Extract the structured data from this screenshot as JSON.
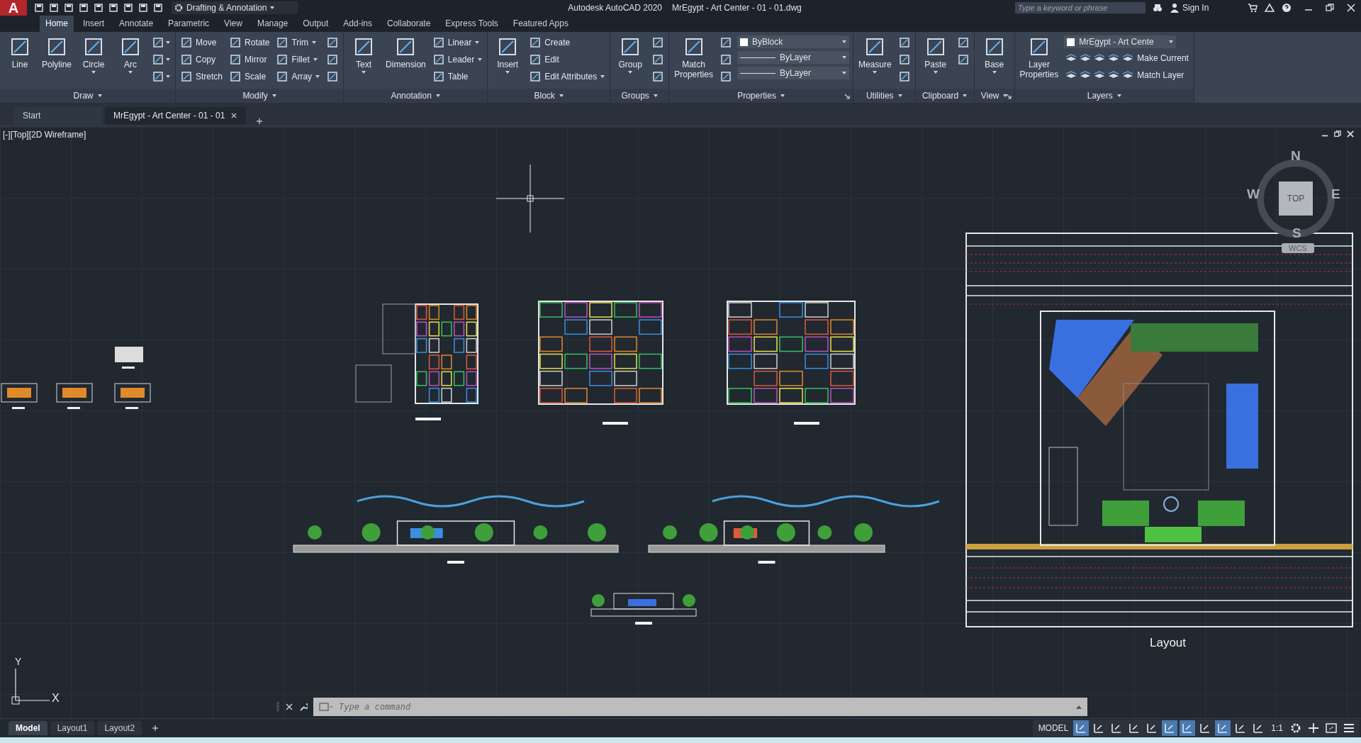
{
  "title_bar": {
    "logo": "A",
    "workspace": "Drafting & Annotation",
    "app_title": "Autodesk AutoCAD 2020",
    "file_title": "MrEgypt - Art Center - 01 - 01.dwg",
    "search": {
      "placeholder": "Type a keyword or phrase"
    },
    "sign_in": "Sign In"
  },
  "ribbon_tabs": [
    {
      "label": "Home",
      "selected": true
    },
    {
      "label": "Insert",
      "selected": false
    },
    {
      "label": "Annotate",
      "selected": false
    },
    {
      "label": "Parametric",
      "selected": false
    },
    {
      "label": "View",
      "selected": false
    },
    {
      "label": "Manage",
      "selected": false
    },
    {
      "label": "Output",
      "selected": false
    },
    {
      "label": "Add-ins",
      "selected": false
    },
    {
      "label": "Collaborate",
      "selected": false
    },
    {
      "label": "Express Tools",
      "selected": false
    },
    {
      "label": "Featured Apps",
      "selected": false
    }
  ],
  "panels": [
    {
      "title": "Draw",
      "launcher": false,
      "columns": [
        [
          {
            "kind": "large",
            "label": "Line",
            "dropdown": false
          }
        ],
        [
          {
            "kind": "large",
            "label": "Polyline",
            "dropdown": false
          }
        ],
        [
          {
            "kind": "large",
            "label": "Circle",
            "dropdown": true
          }
        ],
        [
          {
            "kind": "large",
            "label": "Arc",
            "dropdown": true
          }
        ],
        [
          {
            "kind": "icon",
            "dropdown": true
          },
          {
            "kind": "icon",
            "dropdown": true
          },
          {
            "kind": "icon",
            "dropdown": true
          }
        ]
      ]
    },
    {
      "title": "Modify",
      "launcher": false,
      "columns": [
        [
          {
            "kind": "small",
            "label": "Move",
            "dropdown": false
          },
          {
            "kind": "small",
            "label": "Copy",
            "dropdown": false
          },
          {
            "kind": "small",
            "label": "Stretch",
            "dropdown": false
          }
        ],
        [
          {
            "kind": "small",
            "label": "Rotate",
            "dropdown": false
          },
          {
            "kind": "small",
            "label": "Mirror",
            "dropdown": false
          },
          {
            "kind": "small",
            "label": "Scale",
            "dropdown": false
          }
        ],
        [
          {
            "kind": "small",
            "label": "Trim",
            "dropdown": true
          },
          {
            "kind": "small",
            "label": "Fillet",
            "dropdown": true
          },
          {
            "kind": "small",
            "label": "Array",
            "dropdown": true
          }
        ],
        [
          {
            "kind": "icon",
            "dropdown": false
          },
          {
            "kind": "icon",
            "dropdown": false
          },
          {
            "kind": "icon",
            "dropdown": false
          }
        ]
      ]
    },
    {
      "title": "Annotation",
      "launcher": false,
      "columns": [
        [
          {
            "kind": "large",
            "label": "Text",
            "dropdown": true
          }
        ],
        [
          {
            "kind": "large",
            "label": "Dimension",
            "dropdown": false
          }
        ],
        [
          {
            "kind": "small",
            "label": "Linear",
            "dropdown": true
          },
          {
            "kind": "small",
            "label": "Leader",
            "dropdown": true
          },
          {
            "kind": "small",
            "label": "Table",
            "dropdown": false
          }
        ]
      ]
    },
    {
      "title": "Block",
      "launcher": false,
      "columns": [
        [
          {
            "kind": "large",
            "label": "Insert",
            "dropdown": true
          }
        ],
        [
          {
            "kind": "small",
            "label": "Create",
            "dropdown": false
          },
          {
            "kind": "small",
            "label": "Edit",
            "dropdown": false
          },
          {
            "kind": "small",
            "label": "Edit Attributes",
            "dropdown": true
          }
        ]
      ]
    },
    {
      "title": "Groups",
      "launcher": false,
      "columns": [
        [
          {
            "kind": "large",
            "label": "Group",
            "dropdown": true
          }
        ],
        [
          {
            "kind": "icon",
            "dropdown": false
          },
          {
            "kind": "icon",
            "dropdown": false
          },
          {
            "kind": "icon",
            "dropdown": false
          }
        ]
      ]
    },
    {
      "title": "Properties",
      "launcher": true,
      "columns": [
        [
          {
            "kind": "large",
            "label": "Match Properties",
            "dropdown": false
          }
        ],
        [
          {
            "kind": "icon",
            "dropdown": false
          },
          {
            "kind": "icon",
            "dropdown": false
          },
          {
            "kind": "icon",
            "dropdown": false
          }
        ],
        [
          {
            "kind": "combo",
            "value": "ByBlock",
            "swatch": true,
            "line_sample": false
          },
          {
            "kind": "combo",
            "value": "ByLayer",
            "swatch": false,
            "line_sample": true
          },
          {
            "kind": "combo",
            "value": "ByLayer",
            "swatch": false,
            "line_sample": true
          }
        ]
      ]
    },
    {
      "title": "Utilities",
      "launcher": false,
      "columns": [
        [
          {
            "kind": "large",
            "label": "Measure",
            "dropdown": true
          }
        ],
        [
          {
            "kind": "icon",
            "dropdown": false
          },
          {
            "kind": "icon",
            "dropdown": false
          },
          {
            "kind": "icon",
            "dropdown": false
          }
        ]
      ]
    },
    {
      "title": "Clipboard",
      "launcher": false,
      "columns": [
        [
          {
            "kind": "large",
            "label": "Paste",
            "dropdown": true
          }
        ],
        [
          {
            "kind": "icon",
            "dropdown": false
          },
          {
            "kind": "icon",
            "dropdown": false
          }
        ]
      ]
    },
    {
      "title": "View",
      "launcher": true,
      "columns": [
        [
          {
            "kind": "large",
            "label": "Base",
            "dropdown": true
          }
        ]
      ]
    },
    {
      "title": "Layers",
      "launcher": false,
      "columns": [
        [
          {
            "kind": "large",
            "label": "Layer Properties",
            "dropdown": false
          }
        ],
        [
          {
            "kind": "combo",
            "value": "MrEgypt - Art Cente",
            "swatch": true,
            "line_sample": false
          },
          {
            "kind": "row",
            "items": [
              {
                "kind": "icon",
                "dropdown": false
              },
              {
                "kind": "icon",
                "dropdown": false
              },
              {
                "kind": "icon",
                "dropdown": false
              },
              {
                "kind": "icon",
                "dropdown": false
              },
              {
                "kind": "small",
                "label": "Make Current",
                "dropdown": false
              }
            ]
          },
          {
            "kind": "row",
            "items": [
              {
                "kind": "icon",
                "dropdown": false
              },
              {
                "kind": "icon",
                "dropdown": false
              },
              {
                "kind": "icon",
                "dropdown": false
              },
              {
                "kind": "icon",
                "dropdown": false
              },
              {
                "kind": "small",
                "label": "Match Layer",
                "dropdown": false
              }
            ]
          }
        ]
      ]
    }
  ],
  "file_tabs": [
    {
      "label": "Start",
      "selected": false,
      "closable": false
    },
    {
      "label": "MrEgypt - Art Center - 01 - 01",
      "selected": true,
      "closable": true
    }
  ],
  "viewport": {
    "view_label": "[-][Top][2D Wireframe]",
    "viewcube": {
      "north": "N",
      "south": "S",
      "east": "E",
      "west": "W",
      "face": "TOP",
      "ucs": "WCS"
    },
    "caption": "Layout",
    "ucs_axes": {
      "x": "X",
      "y": "Y"
    }
  },
  "command_line": {
    "placeholder": "Type a command"
  },
  "layout_tabs": [
    {
      "label": "Model",
      "selected": true
    },
    {
      "label": "Layout1",
      "selected": false
    },
    {
      "label": "Layout2",
      "selected": false
    }
  ],
  "status_bar": {
    "space": "MODEL",
    "scale": "1:1",
    "toggles": [
      {
        "on": true
      },
      {
        "on": false
      },
      {
        "on": false
      },
      {
        "on": false
      },
      {
        "on": false
      },
      {
        "on": true
      },
      {
        "on": true
      },
      {
        "on": false
      },
      {
        "on": true
      },
      {
        "on": false
      },
      {
        "on": false
      }
    ]
  }
}
